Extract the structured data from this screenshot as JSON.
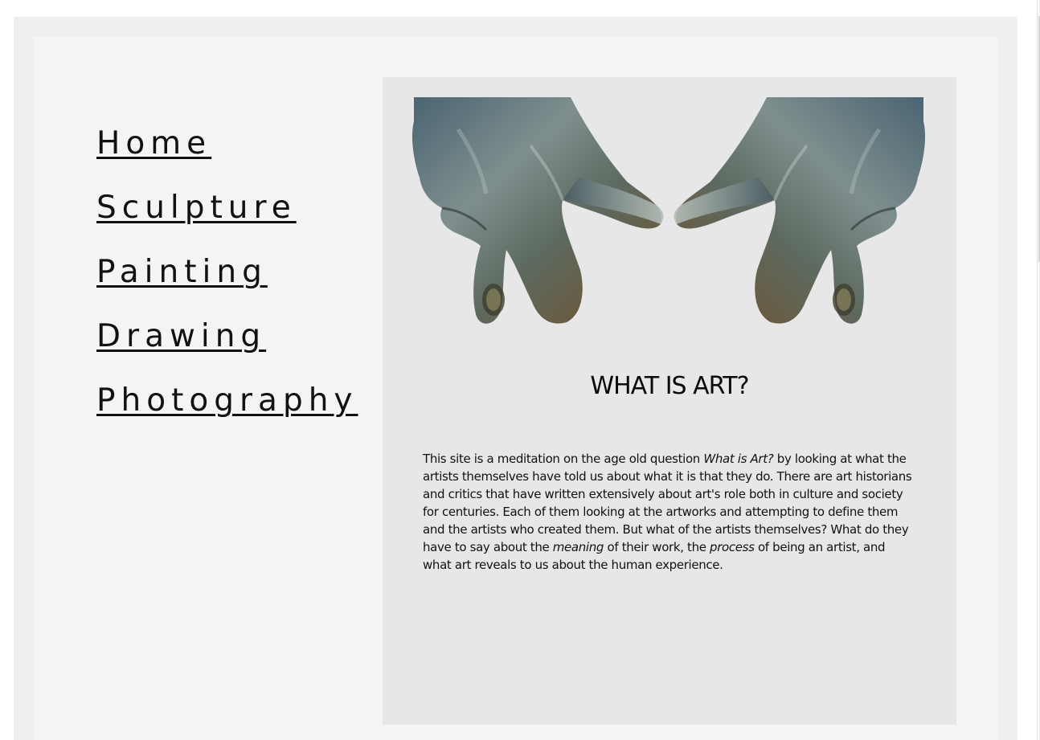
{
  "nav": {
    "items": [
      {
        "label": "Home"
      },
      {
        "label": "Sculpture"
      },
      {
        "label": "Painting"
      },
      {
        "label": "Drawing"
      },
      {
        "label": "Photography"
      }
    ]
  },
  "hero": {
    "image_name": "bronze-hands-sculpture-image"
  },
  "main": {
    "title": "WHAT IS ART?",
    "intro": {
      "part1": "This site is a meditation on the age old question ",
      "em1": "What is Art?",
      "part2": " by looking at what the artists themselves have told us about what it is that they do. There are art historians and critics that have written extensively about art's role both in culture and society for centuries. Each of them looking at the artworks and attempting to define them and the artists who created them. But what of the artists themselves? What do they have to say about the ",
      "em2": "meaning",
      "part3": " of their work, the ",
      "em3": "process",
      "part4": " of being an artist, and what art reveals to us about the human experience."
    }
  },
  "colors": {
    "page_bg": "#efefef",
    "inner_bg": "#f4f4f4",
    "content_bg": "#e7e7e7",
    "text": "#111111"
  }
}
